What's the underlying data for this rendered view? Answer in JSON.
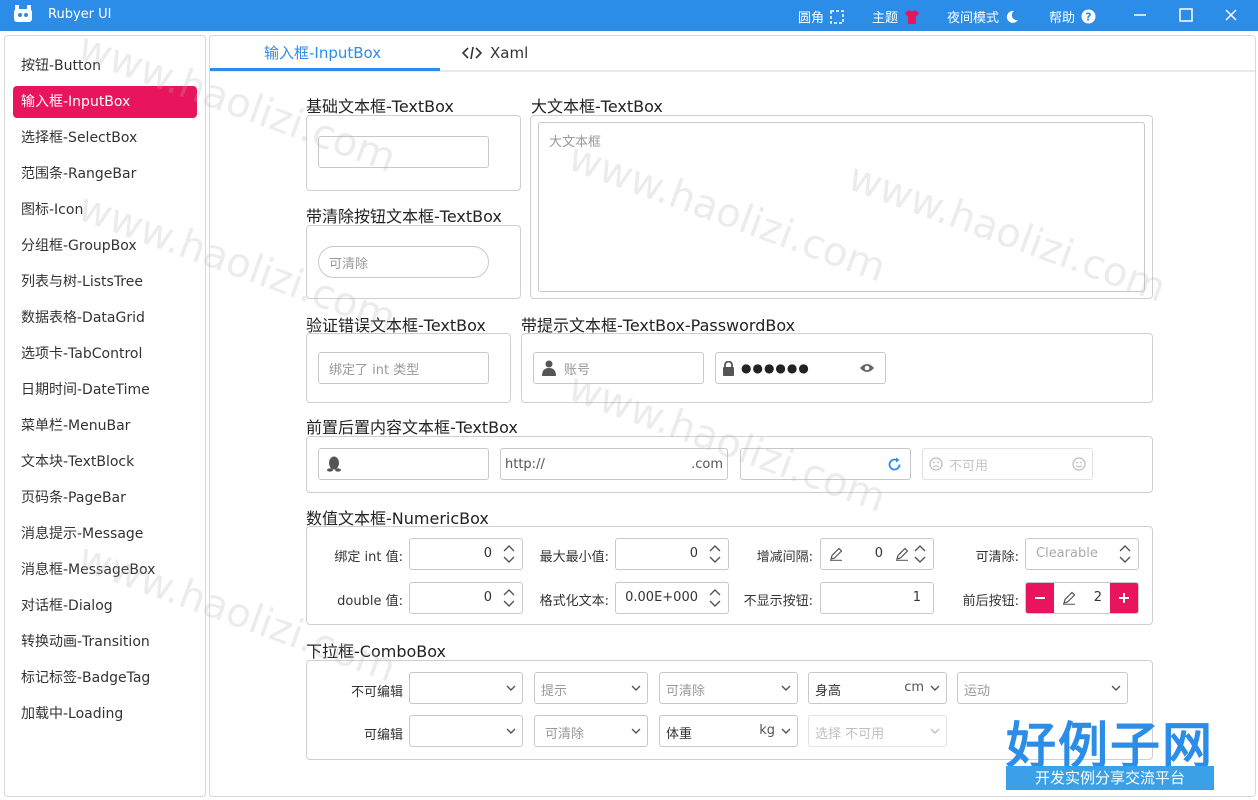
{
  "window": {
    "title": "Rubyer UI",
    "toolbar": {
      "corner_label": "圆角",
      "theme_label": "主题",
      "night_label": "夜间模式",
      "help_label": "帮助"
    }
  },
  "colors": {
    "titlebar": "#2c8de8",
    "accent": "#2c8de8",
    "active_nav": "#e8145e"
  },
  "sidebar": {
    "items": [
      {
        "label": "按钮-Button"
      },
      {
        "label": "输入框-InputBox"
      },
      {
        "label": "选择框-SelectBox"
      },
      {
        "label": "范围条-RangeBar"
      },
      {
        "label": "图标-Icon"
      },
      {
        "label": "分组框-GroupBox"
      },
      {
        "label": "列表与树-ListsTree"
      },
      {
        "label": "数据表格-DataGrid"
      },
      {
        "label": "选项卡-TabControl"
      },
      {
        "label": "日期时间-DateTime"
      },
      {
        "label": "菜单栏-MenuBar"
      },
      {
        "label": "文本块-TextBlock"
      },
      {
        "label": "页码条-PageBar"
      },
      {
        "label": "消息提示-Message"
      },
      {
        "label": "消息框-MessageBox"
      },
      {
        "label": "对话框-Dialog"
      },
      {
        "label": "转换动画-Transition"
      },
      {
        "label": "标记标签-BadgeTag"
      },
      {
        "label": "加载中-Loading"
      }
    ]
  },
  "tabs": {
    "input": "输入框-InputBox",
    "xaml": "Xaml"
  },
  "sections": {
    "basic": {
      "title": "基础文本框-TextBox"
    },
    "big": {
      "title": "大文本框-TextBox",
      "placeholder": "大文本框"
    },
    "clear": {
      "title": "带清除按钮文本框-TextBox",
      "placeholder": "可清除"
    },
    "validate": {
      "title": "验证错误文本框-TextBox",
      "placeholder": "绑定了 int 类型"
    },
    "hint": {
      "title": "带提示文本框-TextBox-PasswordBox",
      "account_placeholder": "账号",
      "password_mask": "●●●●●●"
    },
    "prepost": {
      "title": "前置后置内容文本框-TextBox",
      "url_prefix": "http://",
      "url_suffix": ".com",
      "disabled_text": "不可用"
    },
    "numeric": {
      "title": "数值文本框-NumericBox",
      "rows": [
        {
          "label": "绑定 int 值:",
          "value": "0"
        },
        {
          "label": "最大最小值:",
          "value": "0"
        },
        {
          "label": "增减间隔:",
          "value": "0"
        },
        {
          "label": "可清除:",
          "value": "Clearable"
        },
        {
          "label": "double 值:",
          "value": "0"
        },
        {
          "label": "格式化文本:",
          "value": "0.00E+000"
        },
        {
          "label": "不显示按钮:",
          "value": "1"
        },
        {
          "label": "前后按钮:",
          "value": "2"
        }
      ]
    },
    "combo": {
      "title": "下拉框-ComboBox",
      "row1_label": "不可编辑",
      "row2_label": "可编辑",
      "row1": [
        "",
        "提示",
        "可清除",
        "身高",
        "运动"
      ],
      "row1_unit": "cm",
      "row2": [
        "",
        "可清除",
        "体重",
        "选择  不可用"
      ],
      "row2_unit": "kg"
    }
  },
  "watermark": "www.haolizi.com",
  "brand": {
    "main": "好例子网",
    "sub": "开发实例分享交流平台"
  }
}
